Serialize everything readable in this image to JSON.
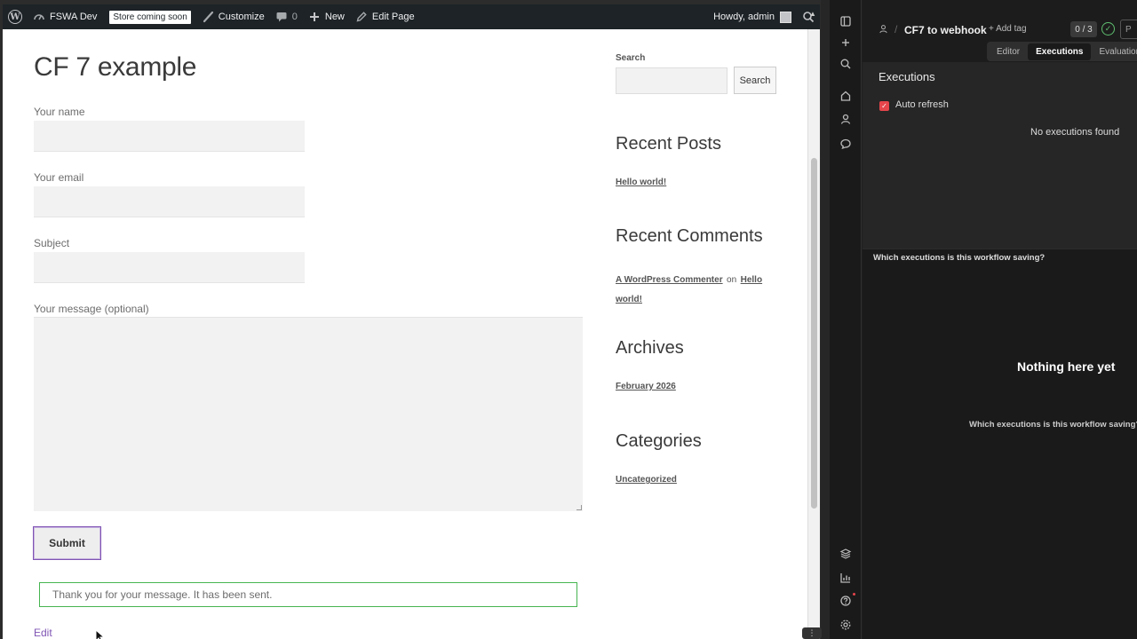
{
  "adminbar": {
    "site_name": "FSWA Dev",
    "store_badge": "Store coming soon",
    "customize": "Customize",
    "comments_count": "0",
    "new": "New",
    "edit_page": "Edit Page",
    "howdy": "Howdy, admin"
  },
  "page": {
    "title": "CF 7 example",
    "fields": {
      "name_label": "Your name",
      "email_label": "Your email",
      "subject_label": "Subject",
      "message_label": "Your message (optional)"
    },
    "submit_label": "Submit",
    "response": "Thank you for your message. It has been sent.",
    "edit_link": "Edit"
  },
  "sidebar": {
    "search_label": "Search",
    "search_button": "Search",
    "recent_posts_title": "Recent Posts",
    "recent_posts": [
      "Hello world!"
    ],
    "recent_comments_title": "Recent Comments",
    "comment_author": "A WordPress Commenter",
    "comment_on": "on",
    "comment_post_1": "Hello",
    "comment_post_2": "world!",
    "archives_title": "Archives",
    "archives": [
      "February 2026"
    ],
    "categories_title": "Categories",
    "categories": [
      "Uncategorized"
    ]
  },
  "n8n": {
    "workflow_name": "CF7 to webhook",
    "add_tag": "+ Add tag",
    "counter": "0 / 3",
    "publish_partial": "P",
    "tabs": [
      "Editor",
      "Executions",
      "Evaluations"
    ],
    "active_tab": "Executions",
    "executions_title": "Executions",
    "auto_refresh": "Auto refresh",
    "no_executions": "No executions found",
    "question": "Which executions is this workflow saving?",
    "nothing_here": "Nothing here yet",
    "question_repeat": "Which executions is this workflow saving?"
  },
  "colors": {
    "adminbar_bg": "#1d2327",
    "accent_purple": "#7f54b3",
    "success_green": "#46b450",
    "n8n_checkbox": "#e5454b"
  }
}
